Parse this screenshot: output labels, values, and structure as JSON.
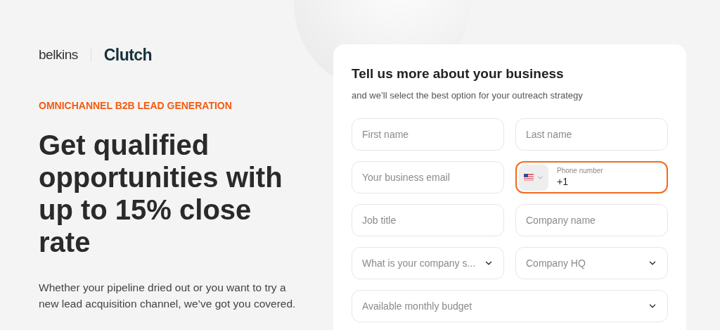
{
  "logos": {
    "brand": "belkins",
    "partner": "Clutch"
  },
  "eyebrow": "OMNICHANNEL B2B LEAD GENERATION",
  "headline": "Get qualified opportunities with up to 15% close rate",
  "description": "Whether your pipeline dried out or you want to try a new lead acquisition channel, we’ve got you covered.",
  "form": {
    "title": "Tell us more about your business",
    "subtitle": "and we’ll select the best option for your outreach strategy",
    "rows": [
      [
        {
          "kind": "input",
          "placeholder": "First name",
          "focused": false
        },
        {
          "kind": "input",
          "placeholder": "Last name",
          "focused": false
        }
      ],
      [
        {
          "kind": "input",
          "placeholder": "Your business email",
          "focused": false
        },
        {
          "kind": "phone",
          "label": "Phone number",
          "value": "+1",
          "focused": true
        }
      ],
      [
        {
          "kind": "input",
          "placeholder": "Job title",
          "focused": false
        },
        {
          "kind": "input",
          "placeholder": "Company name",
          "focused": false
        }
      ],
      [
        {
          "kind": "select",
          "placeholder": "What is your company s...",
          "focused": false
        },
        {
          "kind": "select",
          "placeholder": "Company HQ",
          "focused": false
        }
      ],
      [
        {
          "kind": "select",
          "placeholder": "Available monthly budget",
          "focused": false
        }
      ]
    ]
  }
}
